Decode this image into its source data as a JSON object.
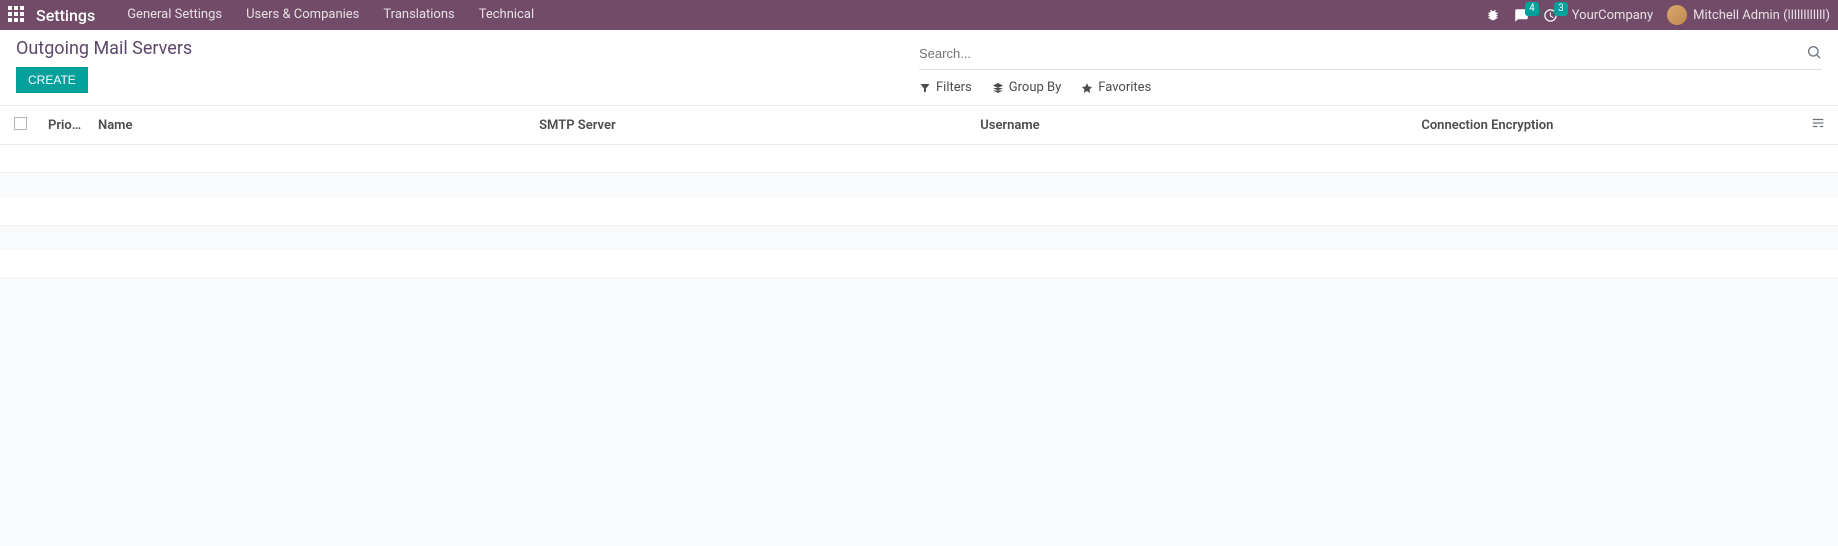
{
  "topbar": {
    "brand": "Settings",
    "menus": [
      {
        "label": "General Settings"
      },
      {
        "label": "Users & Companies"
      },
      {
        "label": "Translations"
      },
      {
        "label": "Technical"
      }
    ],
    "messages_badge": "4",
    "activities_badge": "3",
    "company": "YourCompany",
    "user": "Mitchell Admin (llllllllllll)"
  },
  "control": {
    "breadcrumb": "Outgoing Mail Servers",
    "create": "CREATE",
    "search_placeholder": "Search...",
    "filters": "Filters",
    "groupby": "Group By",
    "favorites": "Favorites"
  },
  "table": {
    "cols": {
      "priority": "Prio...",
      "name": "Name",
      "smtp": "SMTP Server",
      "username": "Username",
      "encryption": "Connection Encryption"
    }
  }
}
